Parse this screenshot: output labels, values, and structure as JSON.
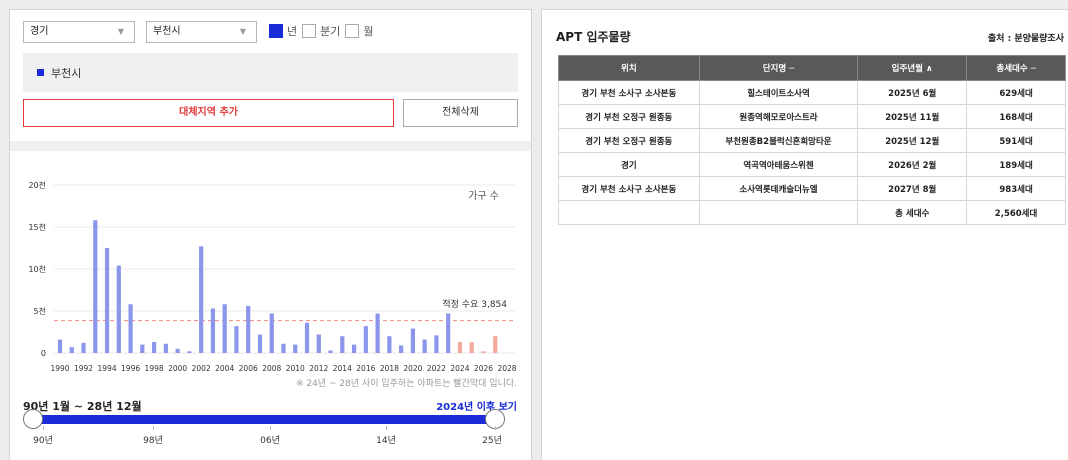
{
  "filters": {
    "province": "경기",
    "city": "부천시",
    "period_options": [
      {
        "label": "년",
        "checked": true
      },
      {
        "label": "분기",
        "checked": false
      },
      {
        "label": "월",
        "checked": false
      }
    ]
  },
  "selected_area": "부천시",
  "buttons": {
    "add_region": "대체지역 추가",
    "delete_all": "전체삭제"
  },
  "chart_data": {
    "type": "bar",
    "legend_label": "가구 수",
    "reference_label": "적정 수요 3,854",
    "reference_value": 3854,
    "ylim": [
      0,
      20000
    ],
    "y_ticks": [
      "0",
      "5천",
      "10천",
      "15천",
      "20천"
    ],
    "x_tick_labels": [
      "1990",
      "1992",
      "1994",
      "1996",
      "1998",
      "2000",
      "2002",
      "2004",
      "2006",
      "2008",
      "2010",
      "2012",
      "2014",
      "2016",
      "2018",
      "2020",
      "2022",
      "2024",
      "2026",
      "2028"
    ],
    "x": [
      1990,
      1991,
      1992,
      1993,
      1994,
      1995,
      1996,
      1997,
      1998,
      1999,
      2000,
      2001,
      2002,
      2003,
      2004,
      2005,
      2006,
      2007,
      2008,
      2009,
      2010,
      2011,
      2012,
      2013,
      2014,
      2015,
      2016,
      2017,
      2018,
      2019,
      2020,
      2021,
      2022,
      2023,
      2024,
      2025,
      2026,
      2027,
      2028
    ],
    "values": [
      1600,
      700,
      1200,
      15800,
      12500,
      10400,
      5800,
      1000,
      1300,
      1100,
      500,
      200,
      12700,
      5300,
      5800,
      3200,
      5600,
      2200,
      4700,
      1100,
      1000,
      3600,
      2200,
      300,
      2000,
      1000,
      3200,
      4700,
      2000,
      900,
      2900,
      1600,
      2100,
      4700,
      1300,
      1300,
      200,
      2000,
      0
    ],
    "series_colors": {
      "historical": "#8c95ec",
      "future": "#f4a99d",
      "reference_line": "#ef8a7e"
    },
    "future_from": 2024
  },
  "note": "※ 24년 ~ 28년 사이 입주하는 아파트는 빨간막대 입니다.",
  "range_label": "90년 1월 ~ 28년 12월",
  "after_link": "2024년 이후 보기",
  "slider_ticks": [
    "90년",
    "98년",
    "06년",
    "14년",
    "25년"
  ],
  "right": {
    "title": "APT 입주물량",
    "source": "출처 : 분양물량조사",
    "columns": [
      "위치",
      "단지명 ─",
      "입주년월 ∧",
      "총세대수 ─"
    ],
    "rows": [
      [
        "경기 부천 소사구 소사본동",
        "힐스테이트소사역",
        "2025년 6월",
        "629세대"
      ],
      [
        "경기 부천 오정구 원종동",
        "원종역해모로아스트라",
        "2025년 11월",
        "168세대"
      ],
      [
        "경기 부천 오정구 원종동",
        "부천원종B2블럭신혼희망타운",
        "2025년 12월",
        "591세대"
      ],
      [
        "경기",
        "역곡역아테움스위첸",
        "2026년 2월",
        "189세대"
      ],
      [
        "경기 부천 소사구 소사본동",
        "소사역롯데캐슬더뉴엘",
        "2027년 8월",
        "983세대"
      ]
    ],
    "total_label": "총 세대수",
    "total_value": "2,560세대"
  }
}
